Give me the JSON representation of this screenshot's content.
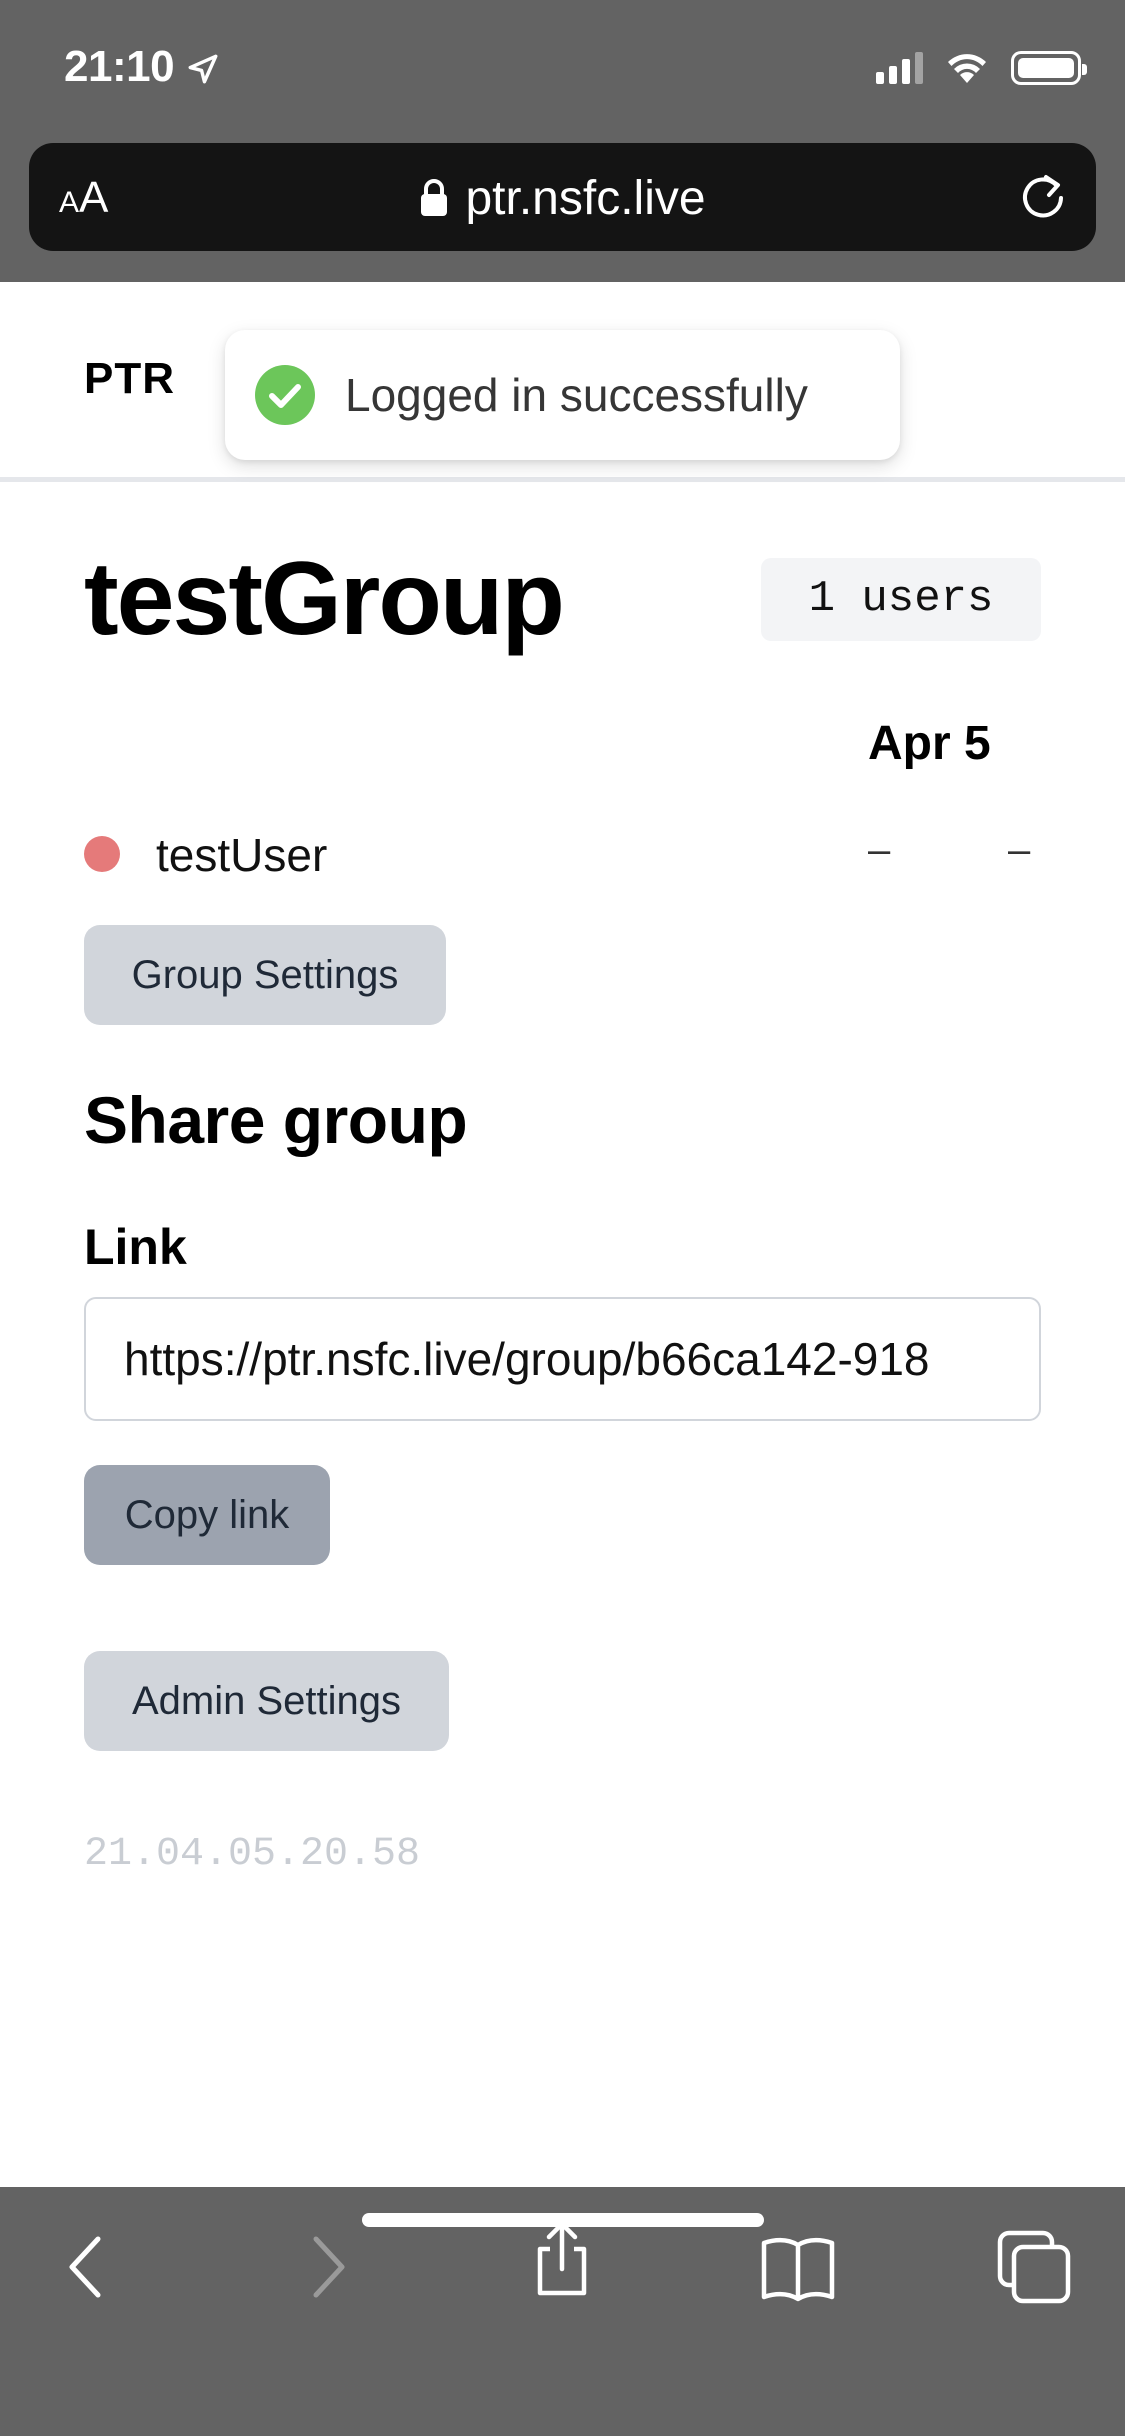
{
  "status_bar": {
    "time": "21:10"
  },
  "browser": {
    "text_size_label_small": "A",
    "text_size_label_large": "A",
    "url": "ptr.nsfc.live"
  },
  "header": {
    "brand": "PTR"
  },
  "toast": {
    "message": "Logged in successfully",
    "color": "#6cc65a"
  },
  "group": {
    "title": "testGroup",
    "users_badge": "1 users",
    "date_column": "Apr 5",
    "members": [
      {
        "name": "testUser",
        "status_color": "#e57a7a",
        "col1": "–",
        "col2": "–"
      }
    ],
    "settings_button": "Group Settings"
  },
  "share": {
    "heading": "Share group",
    "link_label": "Link",
    "link_value": "https://ptr.nsfc.live/group/b66ca142-918",
    "copy_button": "Copy link"
  },
  "admin": {
    "settings_button": "Admin Settings"
  },
  "footer": {
    "version": "21.04.05.20.58"
  }
}
